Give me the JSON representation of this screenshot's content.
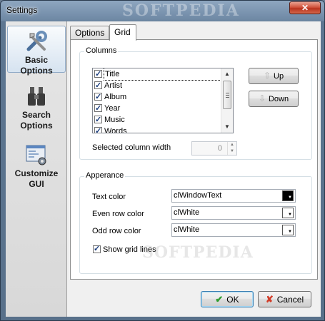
{
  "window": {
    "title": "Settings",
    "watermark": "SOFTPEDIA",
    "close_glyph": "✕"
  },
  "sidebar": {
    "items": [
      {
        "label_line1": "Basic Options",
        "label_line2": "",
        "icon": "tools-icon",
        "active": true
      },
      {
        "label_line1": "Search",
        "label_line2": "Options",
        "icon": "binoculars-icon",
        "active": false
      },
      {
        "label_line1": "Customize",
        "label_line2": "GUI",
        "icon": "window-settings-icon",
        "active": false
      }
    ]
  },
  "tabs": [
    {
      "label": "Options",
      "active": false
    },
    {
      "label": "Grid",
      "active": true
    }
  ],
  "columns_group": {
    "label": "Columns",
    "items": [
      {
        "label": "Title",
        "checked": true
      },
      {
        "label": "Artist",
        "checked": true
      },
      {
        "label": "Album",
        "checked": true
      },
      {
        "label": "Year",
        "checked": true
      },
      {
        "label": "Music",
        "checked": true
      },
      {
        "label": "Words",
        "checked": true
      }
    ],
    "up_label": "Up",
    "down_label": "Down",
    "width_label": "Selected column width",
    "width_value": "0"
  },
  "appearance_group": {
    "label": "Apperance",
    "text_color_label": "Text color",
    "text_color_value": "clWindowText",
    "text_color_swatch": "#000000",
    "even_row_label": "Even row color",
    "even_row_value": "clWhite",
    "even_row_swatch": "#ffffff",
    "odd_row_label": "Odd row color",
    "odd_row_value": "clWhite",
    "odd_row_swatch": "#ffffff",
    "grid_lines_label": "Show grid lines",
    "grid_lines_checked": true,
    "watermark": "SOFTPEDIA"
  },
  "footer": {
    "ok_label": "OK",
    "cancel_label": "Cancel"
  }
}
